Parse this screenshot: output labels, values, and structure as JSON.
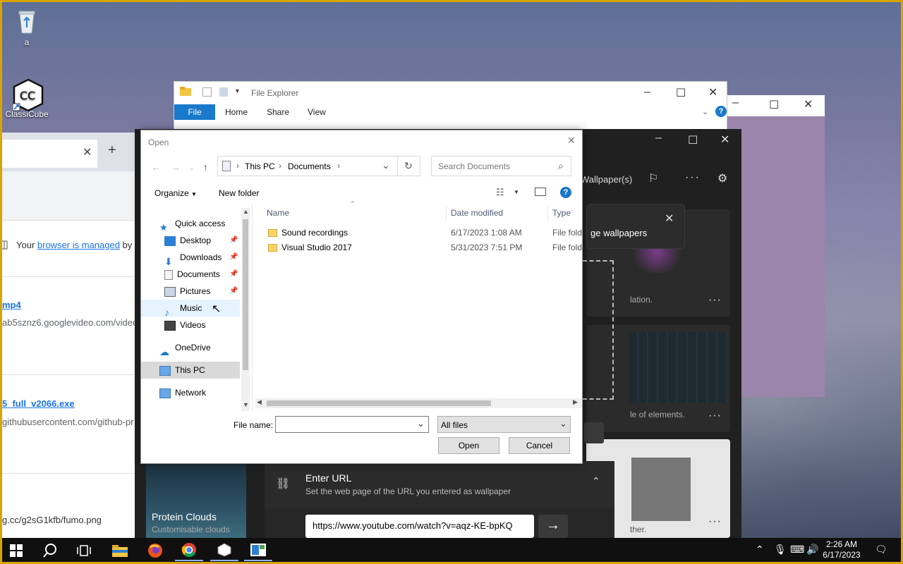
{
  "desktop": {
    "icons": [
      {
        "label": "a"
      },
      {
        "label": "ClassiCube"
      }
    ]
  },
  "browser": {
    "managed_prefix": "Your ",
    "managed_link": "browser is managed",
    "managed_suffix": " by",
    "downloads": [
      {
        "name": "mp4",
        "url": "ab5sznz6.googlevideo.com/video"
      },
      {
        "name": "5_full_v2066.exe",
        "url": "githubusercontent.com/github-pr"
      },
      {
        "url": "g.cc/g2sG1kfb/fumo.png"
      }
    ]
  },
  "explorer": {
    "title": "File Explorer",
    "tabs": [
      "File",
      "Home",
      "Share",
      "View"
    ]
  },
  "wallpaper_app": {
    "toolbar_label": "Wallpaper(s)",
    "toast_text": "ge wallpapers",
    "card1_desc": "lation.",
    "card2_desc": "le of elements.",
    "card3_desc": "ther.",
    "protein_title": "Protein Clouds",
    "protein_sub": "Customisable clouds",
    "enter_url_title": "Enter URL",
    "enter_url_sub": "Set the web page of the URL you entered as wallpaper",
    "url_value": "https://www.youtube.com/watch?v=aqz-KE-bpKQ"
  },
  "dialog": {
    "title": "Open",
    "breadcrumb": [
      "This PC",
      "Documents"
    ],
    "search_placeholder": "Search Documents",
    "organize": "Organize",
    "new_folder": "New folder",
    "nav": {
      "quick_access": "Quick access",
      "desktop": "Desktop",
      "downloads": "Downloads",
      "documents": "Documents",
      "pictures": "Pictures",
      "music": "Music",
      "videos": "Videos",
      "onedrive": "OneDrive",
      "this_pc": "This PC",
      "network": "Network"
    },
    "columns": {
      "name": "Name",
      "date": "Date modified",
      "type": "Type"
    },
    "files": [
      {
        "name": "Sound recordings",
        "date": "6/17/2023 1:08 AM",
        "type": "File folde"
      },
      {
        "name": "Visual Studio 2017",
        "date": "5/31/2023 7:51 PM",
        "type": "File folde"
      }
    ],
    "filename_label": "File name:",
    "filename_value": "",
    "filter": "All files",
    "open_btn": "Open",
    "cancel_btn": "Cancel"
  },
  "taskbar": {
    "time": "2:26 AM",
    "date": "6/17/2023"
  }
}
